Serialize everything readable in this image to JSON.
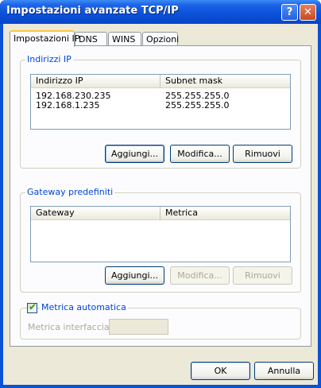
{
  "window": {
    "title": "Impostazioni avanzate TCP/IP",
    "help_glyph": "?",
    "close_glyph": "✕"
  },
  "tabs": [
    {
      "label": "Impostazioni IP",
      "active": true
    },
    {
      "label": "DNS",
      "active": false
    },
    {
      "label": "WINS",
      "active": false
    },
    {
      "label": "Opzioni",
      "active": false
    }
  ],
  "ip_group": {
    "label": "Indirizzi IP",
    "columns": [
      "Indirizzo IP",
      "Subnet mask"
    ],
    "rows": [
      {
        "address": "192.168.230.235",
        "mask": "255.255.255.0"
      },
      {
        "address": "192.168.1.235",
        "mask": "255.255.255.0"
      }
    ],
    "add_label": "Aggiungi...",
    "edit_label": "Modifica...",
    "remove_label": "Rimuovi"
  },
  "gateway_group": {
    "label": "Gateway predefiniti",
    "columns": [
      "Gateway",
      "Metrica"
    ],
    "add_label": "Aggiungi...",
    "edit_label": "Modifica...",
    "remove_label": "Rimuovi"
  },
  "metric": {
    "auto_label": "Metrica automatica",
    "auto_checked": true,
    "interface_label": "Metrica interfaccia:",
    "interface_value": ""
  },
  "footer": {
    "ok_label": "OK",
    "cancel_label": "Annulla"
  }
}
